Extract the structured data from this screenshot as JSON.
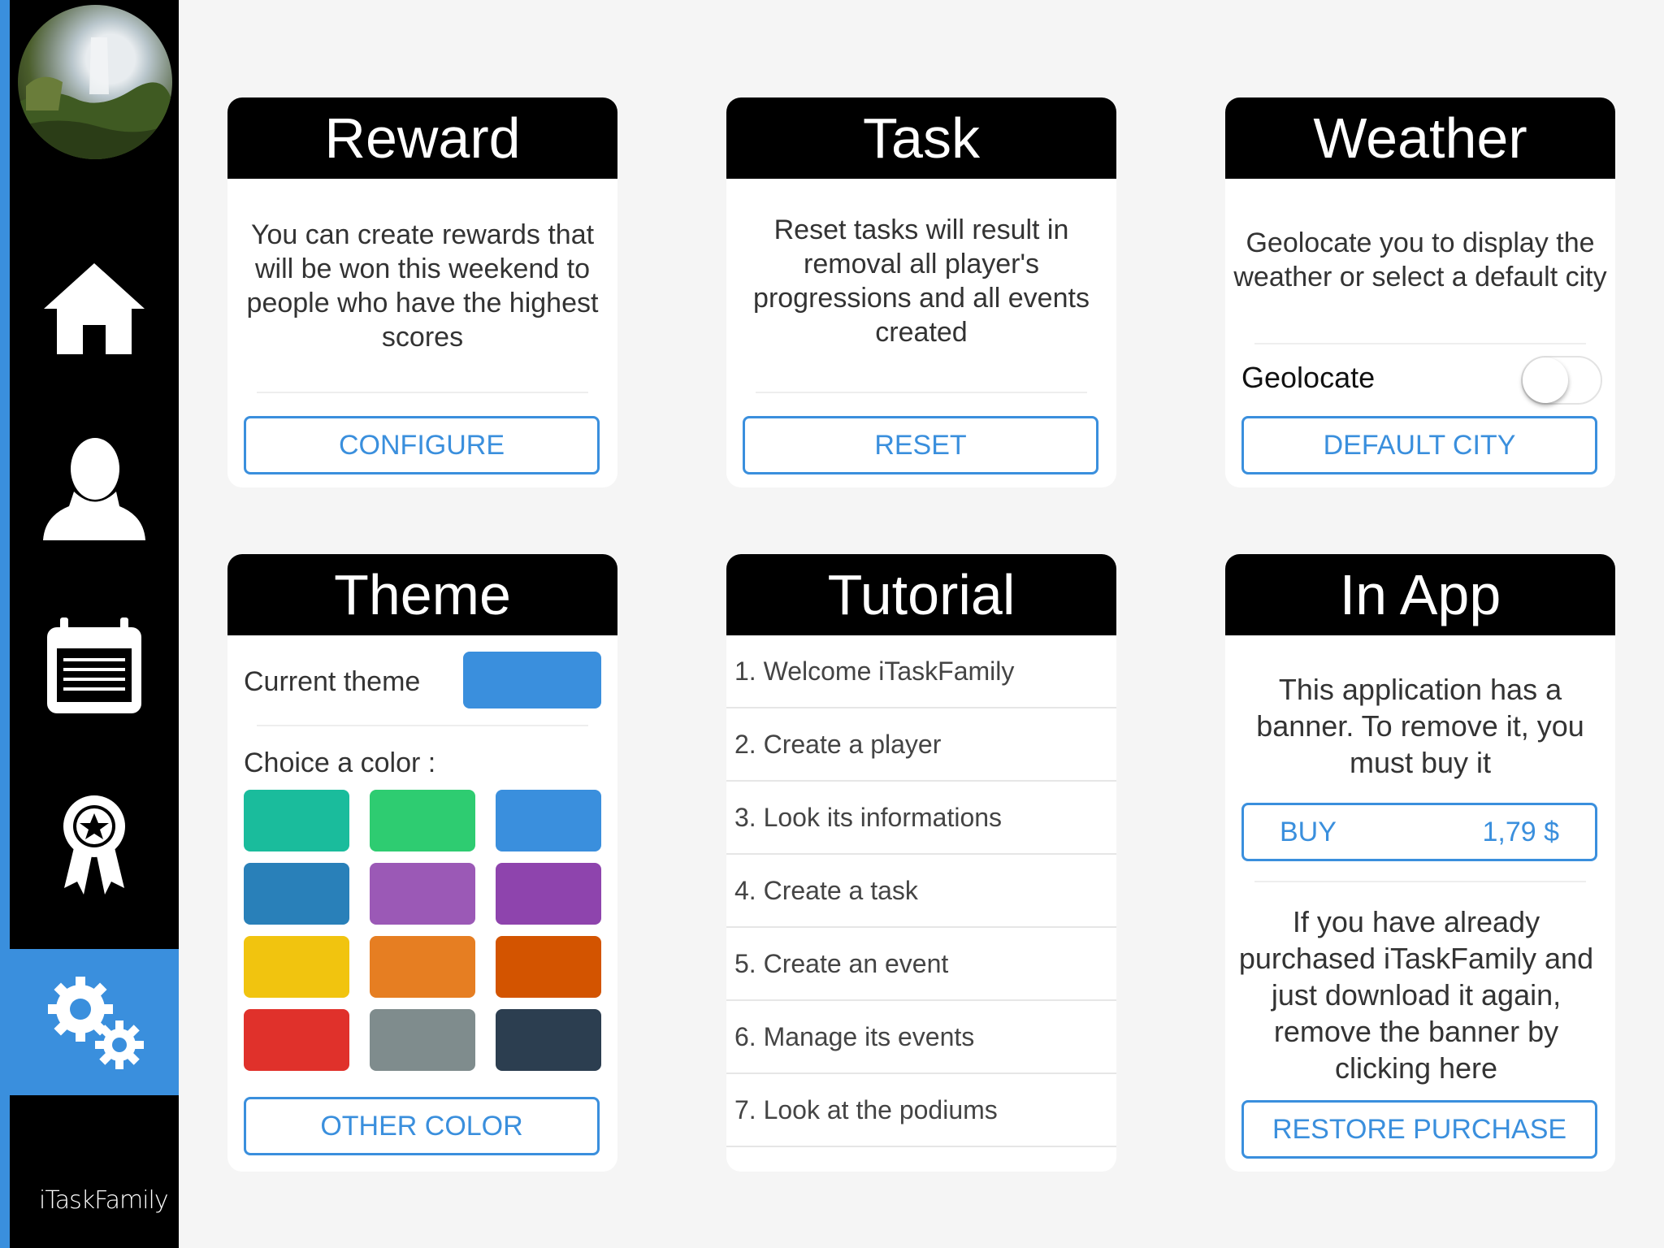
{
  "app": {
    "brand": "iTaskFamily"
  },
  "sidebar": {
    "accent_color": "#3a8fdd",
    "items": [
      {
        "name": "home",
        "icon": "home-icon"
      },
      {
        "name": "player",
        "icon": "user-icon"
      },
      {
        "name": "events",
        "icon": "calendar-icon"
      },
      {
        "name": "podium",
        "icon": "award-icon"
      },
      {
        "name": "settings",
        "icon": "gears-icon",
        "active": true
      }
    ]
  },
  "reward": {
    "title": "Reward",
    "description": "You can create rewards that will be won this weekend to people who have the highest scores",
    "button": "CONFIGURE"
  },
  "task": {
    "title": "Task",
    "description": "Reset tasks will result in removal all player's progressions and all events created",
    "button": "RESET"
  },
  "weather": {
    "title": "Weather",
    "description": "Geolocate you to display the weather or select a default city",
    "geolocate_label": "Geolocate",
    "geolocate_on": false,
    "button": "DEFAULT CITY"
  },
  "theme": {
    "title": "Theme",
    "current_label": "Current theme",
    "current_color": "#3a8fdd",
    "choice_label": "Choice a color :",
    "colors": [
      "#1abc9c",
      "#2ecc71",
      "#3a8fdd",
      "#2980b9",
      "#9b59b6",
      "#8e44ad",
      "#f1c40f",
      "#e67e22",
      "#d35400",
      "#e0312b",
      "#7f8c8d",
      "#2c3e50"
    ],
    "button": "OTHER COLOR"
  },
  "tutorial": {
    "title": "Tutorial",
    "items": [
      "1. Welcome iTaskFamily",
      "2. Create a player",
      "3. Look its informations",
      "4. Create a task",
      "5. Create an event",
      "6. Manage its events",
      "7. Look at the podiums"
    ]
  },
  "inapp": {
    "title": "In App",
    "description": "This application has a banner. To remove it, you must buy it",
    "buy_label": "BUY",
    "buy_price": "1,79 $",
    "restore_text": "If you have already purchased iTaskFamily and just download it again, remove the banner by clicking here",
    "restore_button": "RESTORE PURCHASE"
  }
}
